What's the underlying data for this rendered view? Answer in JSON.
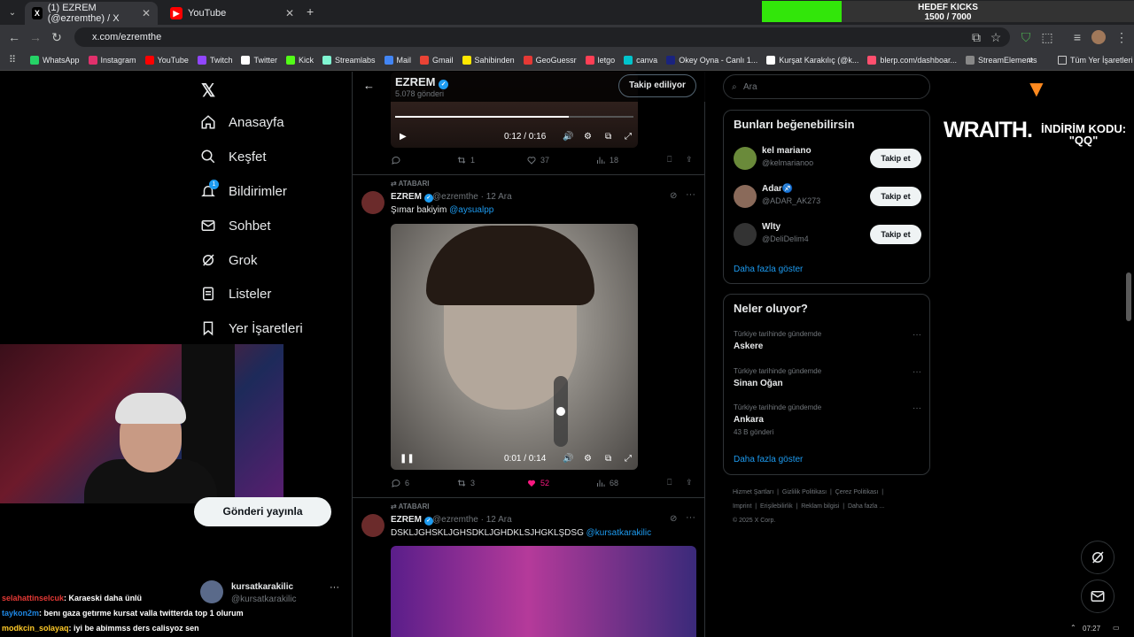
{
  "browser": {
    "tabs": [
      {
        "label": "(1) EZREM (@ezremthe) / X",
        "icon": "x-logo"
      },
      {
        "label": "YouTube",
        "icon": "youtube-logo"
      }
    ],
    "url": "x.com/ezremthe",
    "new_tab": "+",
    "bookmarks": [
      {
        "label": "WhatsApp",
        "color": "#25d366"
      },
      {
        "label": "Instagram",
        "color": "#e1306c"
      },
      {
        "label": "YouTube",
        "color": "#ff0000"
      },
      {
        "label": "Twitch",
        "color": "#9146ff"
      },
      {
        "label": "Twitter",
        "color": "#ffffff"
      },
      {
        "label": "Kick",
        "color": "#53fc18"
      },
      {
        "label": "Streamlabs",
        "color": "#80f5d2"
      },
      {
        "label": "Mail",
        "color": "#4285f4"
      },
      {
        "label": "Gmail",
        "color": "#ea4335"
      },
      {
        "label": "Sahibinden",
        "color": "#ffe800"
      },
      {
        "label": "GeoGuessr",
        "color": "#e53935"
      },
      {
        "label": "letgo",
        "color": "#ff3f55"
      },
      {
        "label": "canva",
        "color": "#00c4cc"
      },
      {
        "label": "Okey Oyna - Canlı 1...",
        "color": "#1a237e"
      },
      {
        "label": "Kurşat Karakılıç (@k...",
        "color": "#ffffff"
      },
      {
        "label": "blerp.com/dashboar...",
        "color": "#ff4f6e"
      },
      {
        "label": "StreamElements",
        "color": "#888888"
      }
    ],
    "all_bookmarks": "Tüm Yer İşaretleri"
  },
  "kick_goal": {
    "title": "HEDEF KICKS",
    "progress": "1500 / 7000",
    "fraction": 0.214
  },
  "nav": {
    "items": [
      "Anasayfa",
      "Keşfet",
      "Bildirimler",
      "Sohbet",
      "Grok",
      "Listeler",
      "Yer İşaretleri"
    ],
    "notif_badge": "1",
    "post_button": "Gönderi yayınla",
    "account_name": "kursatkarakilic",
    "account_handle": "@kursatkarakilic"
  },
  "profile_header": {
    "name": "EZREM",
    "posts": "5.078 gönderi",
    "follow_btn": "Takip ediliyor"
  },
  "tweets": [
    {
      "video_time": "0:12 / 0:16",
      "replies": "",
      "retweets": "1",
      "likes": "37",
      "views": "18"
    },
    {
      "repost_label": "ATABARI",
      "name": "EZREM",
      "handle": "@ezremthe",
      "date": "· 12 Ara",
      "text": "Şımar bakiyim",
      "mention": "@aysualpp",
      "video_time": "0:01 / 0:14",
      "replies": "6",
      "retweets": "3",
      "likes": "52",
      "views": "68"
    },
    {
      "repost_label": "ATABARI",
      "name": "EZREM",
      "handle": "@ezremthe",
      "date": "· 12 Ara",
      "text": "DSKLJGHSKLJGHSDKLJGHDKLSJHGKLŞDSG",
      "mention": "@kursatkarakilic"
    }
  ],
  "sidebar": {
    "search_placeholder": "Ara",
    "who_title": "Bunları beğenebilirsin",
    "who": [
      {
        "name": "kel mariano",
        "handle": "@kelmarianoo",
        "btn": "Takip et"
      },
      {
        "name": "Adar♐",
        "handle": "@ADAR_AK273",
        "btn": "Takip et"
      },
      {
        "name": "Wlty",
        "handle": "@DeliDelim4",
        "btn": "Takip et"
      }
    ],
    "show_more": "Daha fazla göster",
    "trends_title": "Neler oluyor?",
    "trends": [
      {
        "context": "Türkiye tarihinde gündemde",
        "name": "Askere",
        "posts": ""
      },
      {
        "context": "Türkiye tarihinde gündemde",
        "name": "Sinan Oğan",
        "posts": ""
      },
      {
        "context": "Türkiye tarihinde gündemde",
        "name": "Ankara",
        "posts": "43 B gönderi"
      }
    ],
    "trends_more": "Daha fazla göster",
    "footer_links": [
      "Hizmet Şartları",
      "Gizlilik Politikası",
      "Çerez Politikası",
      "Imprint",
      "Erişilebilirlik",
      "Reklam bilgisi",
      "Daha fazla ..."
    ],
    "copyright": "© 2025 X Corp."
  },
  "overlay": {
    "brand": "WRAITH.",
    "code_line1": "İNDİRİM KODU:",
    "code_line2": "\"QQ\""
  },
  "chat": [
    {
      "user": "selahattinselcuk",
      "color": "#e53935",
      "msg": ": Karaeski daha ünlü"
    },
    {
      "user": "taykon2m",
      "color": "#1e88e5",
      "msg": ": benı gaza getırme kursat valla twitterda top 1 olurum"
    },
    {
      "user": "modkcin_solayaq",
      "color": "#ffca28",
      "msg": ": iyi be abimmss ders calisyoz sen"
    }
  ],
  "taskbar": {
    "time": "07:27"
  }
}
